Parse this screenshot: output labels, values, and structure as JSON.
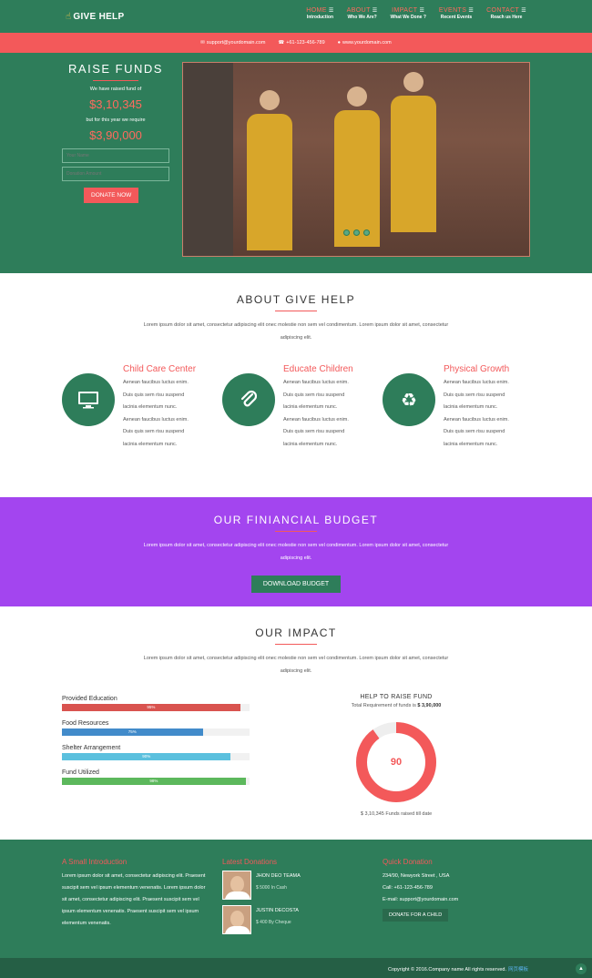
{
  "header": {
    "logo": "GIVE HELP",
    "logo_icon": "hand-icon",
    "nav": [
      {
        "title": "HOME",
        "sub": "Introduction"
      },
      {
        "title": "ABOUT",
        "sub": "Who We Are?"
      },
      {
        "title": "IMPACT",
        "sub": "What We Done ?"
      },
      {
        "title": "EVENTS",
        "sub": "Recent Events"
      },
      {
        "title": "CONTACT",
        "sub": "Reach us Here"
      }
    ]
  },
  "topbar": {
    "email": "support@yourdomain.com",
    "phone": "+61-123-456-789",
    "web": "www.yourdomain.com"
  },
  "hero": {
    "title": "RAISE FUNDS",
    "raised_text": "We have raised fund of",
    "raised_amount": "$3,10,345",
    "require_text": "but for this year we require",
    "require_amount": "$3,90,000",
    "name_placeholder": "Your Name",
    "amount_placeholder": "Donation Amount",
    "donate_label": "DONATE NOW"
  },
  "about": {
    "title": "ABOUT GIVE HELP",
    "text": "Lorem ipsum dolor sit amet, consectetur adipiscing elit onec molestie non sem vel condimentum. Lorem ipsum dolor sit amet, consectetur adipiscing elit.",
    "features": [
      {
        "title": "Child Care Center",
        "icon": "monitor-icon",
        "lines": [
          "Aenean faucibus luctus enim.",
          "Duis quis sem risu suspend",
          "lacinia elementum nunc.",
          "Aenean faucibus luctus enim.",
          "Duis quis sem risu suspend",
          "lacinia elementum nunc."
        ]
      },
      {
        "title": "Educate Children",
        "icon": "paperclip-icon",
        "lines": [
          "Aenean faucibus luctus enim.",
          "Duis quis sem risu suspend",
          "lacinia elementum nunc.",
          "Aenean faucibus luctus enim.",
          "Duis quis sem risu suspend",
          "lacinia elementum nunc."
        ]
      },
      {
        "title": "Physical Growth",
        "icon": "recycle-icon",
        "lines": [
          "Aenean faucibus luctus enim.",
          "Duis quis sem risu suspend",
          "lacinia elementum nunc.",
          "Aenean faucibus luctus enim.",
          "Duis quis sem risu suspend",
          "lacinia elementum nunc."
        ]
      }
    ]
  },
  "budget": {
    "title": "OUR FINIANCIAL BUDGET",
    "text": "Lorem ipsum dolor sit amet, consectetur adipiscing elit onec molestie non sem vel condimentum. Lorem ipsum dolor sit amet, consectetur adipiscing elit.",
    "button": "DOWNLOAD BUDGET"
  },
  "impact": {
    "title": "OUR IMPACT",
    "text": "Lorem ipsum dolor sit amet, consectetur adipiscing elit onec molestie non sem vel condimentum. Lorem ipsum dolor sit amet, consectetur adipiscing elit.",
    "bars": [
      {
        "label": "Provided Education",
        "value": 95,
        "display": "95%",
        "color": "#d9534f"
      },
      {
        "label": "Food Resources",
        "value": 75,
        "display": "75%",
        "color": "#428bca"
      },
      {
        "label": "Shelter Arrangement",
        "value": 90,
        "display": "90%",
        "color": "#5bc0de"
      },
      {
        "label": "Fund Utilized",
        "value": 98,
        "display": "98%",
        "color": "#5cb85c"
      }
    ],
    "raise_title": "HELP TO RAISE FUND",
    "requirement_text": "Total Requirement of funds is",
    "requirement_amount": "$ 3,90,000",
    "donut_value": 90,
    "donut_display": "90",
    "donut_color": "#f3595a",
    "raised_text": "$ 3,10,345 Funds raised till date"
  },
  "footer": {
    "intro_title": "A Small Introduction",
    "intro_text": "Lorem ipsum dolor sit amet, consectetur adipiscing elit. Praesent suscipit sem vel ipsum elementum venenatis. Lorem ipsum dolor sit amet, consectetur adipiscing elit. Praesent suscipit sem vel ipsum elementum venenatis. Praesent suscipit sem vel ipsum elementum venenatis.",
    "donations_title": "Latest Donations",
    "donations": [
      {
        "name": "JHON DEO TEAMA",
        "amount": "$ 5000 In Cash"
      },
      {
        "name": "JUSTIN DECOSTA",
        "amount": "$ 400 By Cheque"
      }
    ],
    "quick_title": "Quick Donation",
    "address": "234/90, Newyork Street , USA",
    "call": "Call: +61-123-456-789",
    "email": "E-mail: support@yourdomain.com",
    "button": "DONATE FOR A CHILD"
  },
  "bottom": {
    "copyright": "Copyright © 2016.Company name All rights reserved.",
    "link": "网页模板"
  }
}
